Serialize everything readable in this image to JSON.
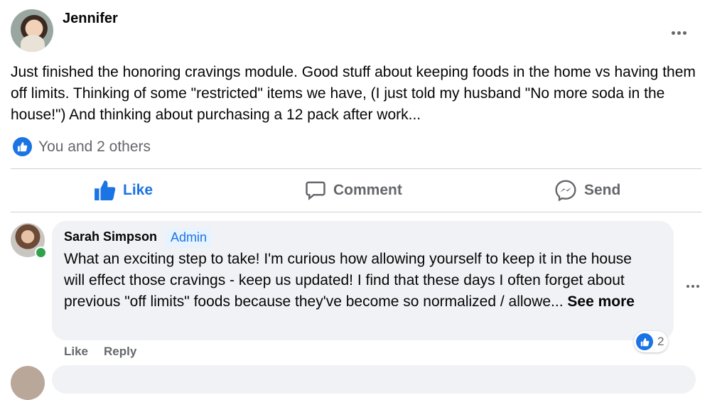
{
  "post": {
    "author": "Jennifer",
    "text": "Just finished the honoring cravings module. Good stuff about keeping foods in the home vs having them off limits. Thinking of some \"restricted\" items we have, (I just told my husband \"No more soda in the house!\") And thinking about purchasing a 12 pack after work...",
    "reactions_text": "You and 2 others",
    "actions": {
      "like": "Like",
      "comment": "Comment",
      "send": "Send"
    }
  },
  "comment": {
    "author": "Sarah Simpson",
    "badge": "Admin",
    "text": "What an exciting step to take! I'm curious how allowing yourself to keep it in the house will effect those cravings - keep us updated! I find that these days I often forget about previous \"off limits\" foods because they've become so normalized / allowe...",
    "see_more": "See more",
    "like": "Like",
    "reply": "Reply",
    "reaction_count": "2"
  },
  "icons": {
    "post_menu": "more-horizontal-icon",
    "reaction": "thumbs-up-icon",
    "comment": "speech-bubble-icon",
    "send": "messenger-icon"
  },
  "colors": {
    "accent": "#1b74e4",
    "muted": "#65676b",
    "online": "#31a24c",
    "bubble": "#f0f2f5"
  }
}
